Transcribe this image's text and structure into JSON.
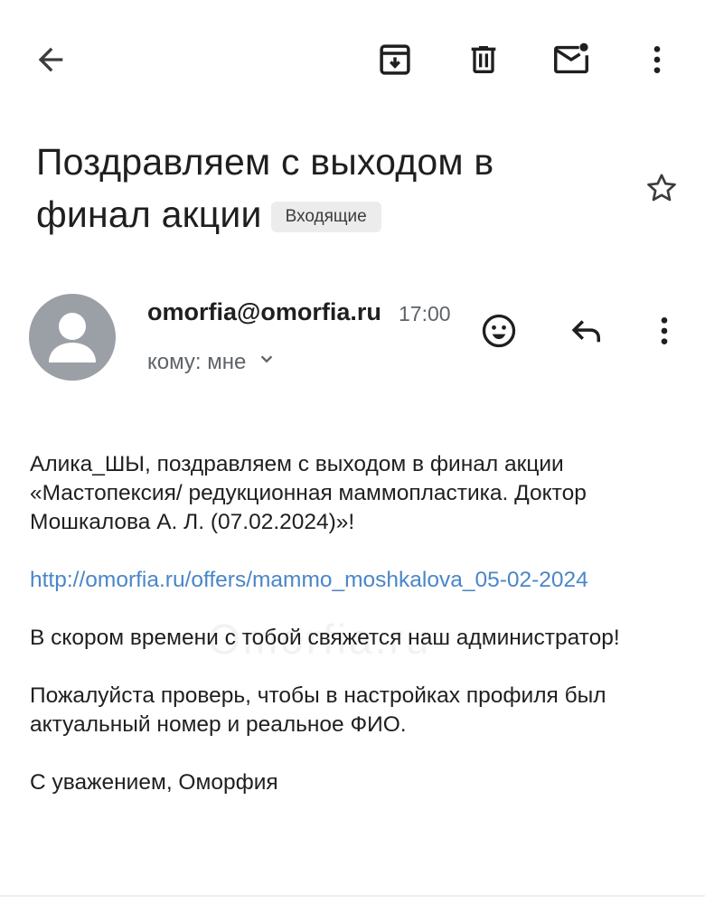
{
  "toolbar": {
    "back_icon": "arrow-back-icon",
    "archive_icon": "archive-icon",
    "delete_icon": "trash-icon",
    "mark_unread_icon": "mail-unread-icon",
    "more_icon": "more-vert-icon"
  },
  "email": {
    "subject": "Поздравляем с выходом в финал акции",
    "label": "Входящие",
    "sender": "omorfia@omorfia.ru",
    "time": "17:00",
    "recipient": "кому: мне",
    "body": {
      "greeting": "Алика_ШЫ, поздравляем с выходом в финал акции «Мастопексия/ редукционная маммопластика. Доктор Мошкалова А. Л. (07.02.2024)»!",
      "link": "http://omorfia.ru/offers/mammo_moshkalova_05-02-2024",
      "admin_note": "В скором времени с тобой свяжется наш администратор!",
      "profile_note": "Пожалуйста проверь, чтобы в настройках профиля был актуальный номер и реальное ФИО.",
      "signature": "С уважением, Оморфия"
    },
    "watermark": "Omorfia.ru"
  },
  "colors": {
    "link": "#4a86c8",
    "avatar_bg": "#9aa0a6",
    "chip_bg": "#ececec",
    "text": "#1f1f1f",
    "secondary_text": "#5f6368"
  }
}
